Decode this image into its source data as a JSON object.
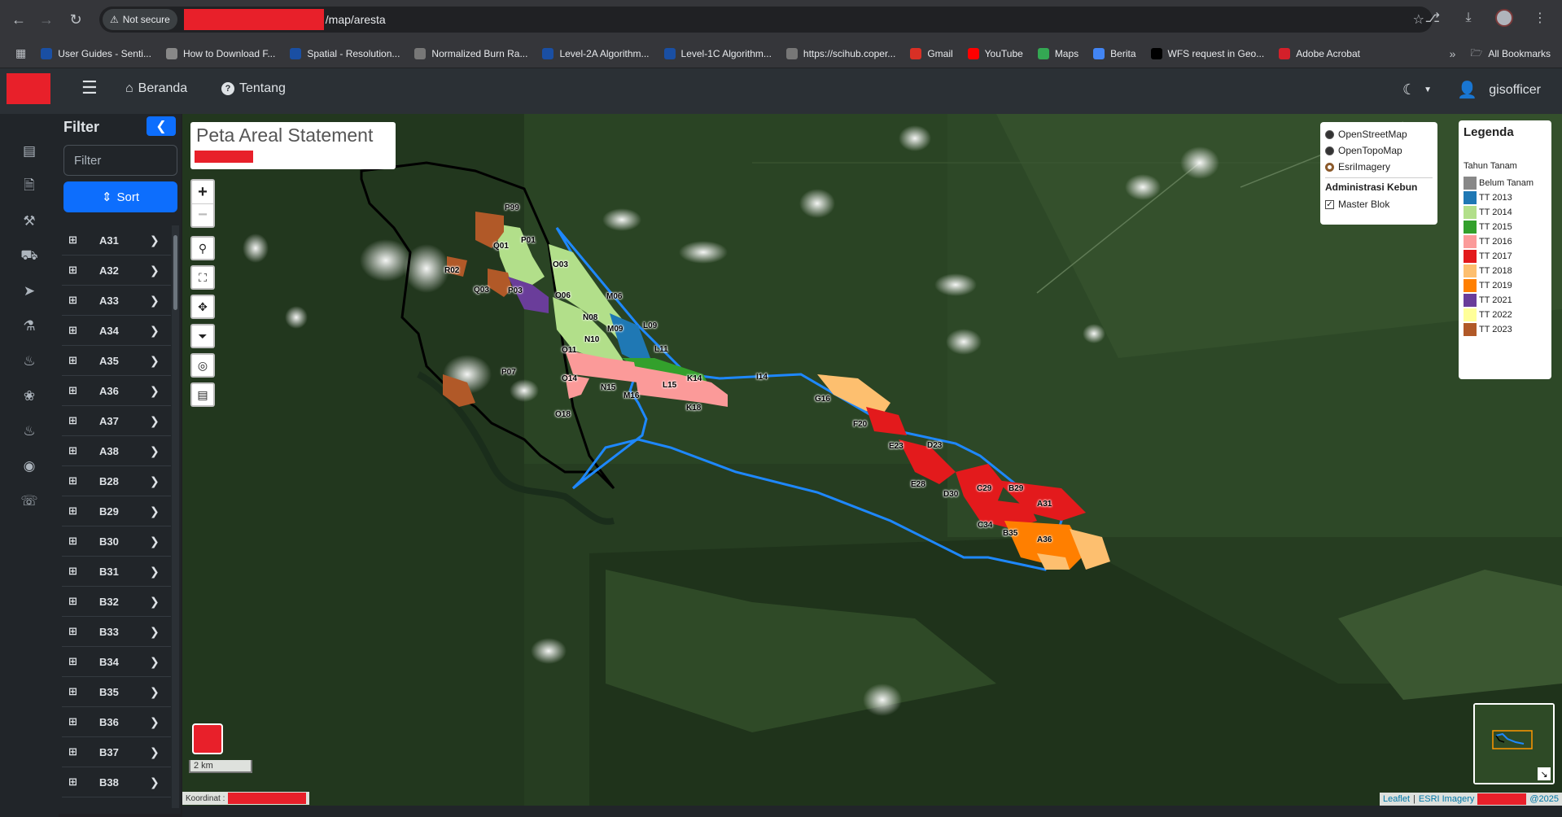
{
  "browser": {
    "security_label": "Not secure",
    "url_path": "/map/aresta",
    "bookmarks": [
      {
        "label": "User Guides - Senti...",
        "icon": "copernicus-icon",
        "color": "#1a4fa3"
      },
      {
        "label": "How to Download F...",
        "icon": "page-icon",
        "color": "#888888"
      },
      {
        "label": "Spatial - Resolution...",
        "icon": "copernicus-icon",
        "color": "#1a4fa3"
      },
      {
        "label": "Normalized Burn Ra...",
        "icon": "globe-icon",
        "color": "#777777"
      },
      {
        "label": "Level-2A Algorithm...",
        "icon": "copernicus-icon",
        "color": "#1a4fa3"
      },
      {
        "label": "Level-1C Algorithm...",
        "icon": "copernicus-icon",
        "color": "#1a4fa3"
      },
      {
        "label": "https://scihub.coper...",
        "icon": "globe-icon",
        "color": "#777777"
      },
      {
        "label": "Gmail",
        "icon": "gmail-icon",
        "color": "#d93025"
      },
      {
        "label": "YouTube",
        "icon": "youtube-icon",
        "color": "#ff0000"
      },
      {
        "label": "Maps",
        "icon": "maps-icon",
        "color": "#34a853"
      },
      {
        "label": "Berita",
        "icon": "news-icon",
        "color": "#4285f4"
      },
      {
        "label": "WFS request in Geo...",
        "icon": "dev-icon",
        "color": "#000000"
      },
      {
        "label": "Adobe Acrobat",
        "icon": "acrobat-icon",
        "color": "#d4202a"
      }
    ],
    "all_bookmarks_label": "All Bookmarks"
  },
  "navbar": {
    "home_label": "Beranda",
    "about_label": "Tentang",
    "username": "gisofficer"
  },
  "filter_panel": {
    "title": "Filter",
    "search_placeholder": "Filter",
    "sort_label": "Sort",
    "blocks": [
      "A31",
      "A32",
      "A33",
      "A34",
      "A35",
      "A36",
      "A37",
      "A38",
      "B28",
      "B29",
      "B30",
      "B31",
      "B32",
      "B33",
      "B34",
      "B35",
      "B36",
      "B37",
      "B38"
    ]
  },
  "map": {
    "title": "Peta Areal Statement",
    "scale_label": "2 km",
    "coordinate_label": "Koordinat :",
    "attribution": {
      "leaflet": "Leaflet",
      "imagery": "ESRI Imagery",
      "year": "@2025"
    },
    "basemaps": [
      {
        "label": "OpenStreetMap",
        "selected": false
      },
      {
        "label": "OpenTopoMap",
        "selected": false
      },
      {
        "label": "EsriImagery",
        "selected": true
      }
    ],
    "overlay_group": "Administrasi Kebun",
    "overlays": [
      {
        "label": "Master Blok",
        "checked": true
      }
    ],
    "legend": {
      "title": "Legenda",
      "subtitle": "Tahun Tanam",
      "items": [
        {
          "label": "Belum Tanam",
          "color": "#888888"
        },
        {
          "label": "TT 2013",
          "color": "#1f78b4"
        },
        {
          "label": "TT 2014",
          "color": "#b2df8a"
        },
        {
          "label": "TT 2015",
          "color": "#33a02c"
        },
        {
          "label": "TT 2016",
          "color": "#fb9a99"
        },
        {
          "label": "TT 2017",
          "color": "#e31a1c"
        },
        {
          "label": "TT 2018",
          "color": "#fdbf6f"
        },
        {
          "label": "TT 2019",
          "color": "#ff7f00"
        },
        {
          "label": "TT 2021",
          "color": "#6a3d9a"
        },
        {
          "label": "TT 2022",
          "color": "#ffff99"
        },
        {
          "label": "TT 2023",
          "color": "#b15928"
        }
      ]
    },
    "block_labels": [
      "P99",
      "Q01",
      "P01",
      "R02",
      "O03",
      "Q03",
      "P03",
      "O06",
      "M06",
      "N08",
      "M09",
      "L09",
      "N10",
      "O11",
      "L11",
      "P07",
      "O14",
      "K14",
      "I14",
      "N15",
      "M16",
      "L15",
      "K18",
      "G16",
      "O18",
      "F20",
      "E23",
      "D23",
      "E28",
      "D30",
      "C29",
      "B29",
      "A31",
      "C34",
      "B35",
      "A36"
    ]
  }
}
